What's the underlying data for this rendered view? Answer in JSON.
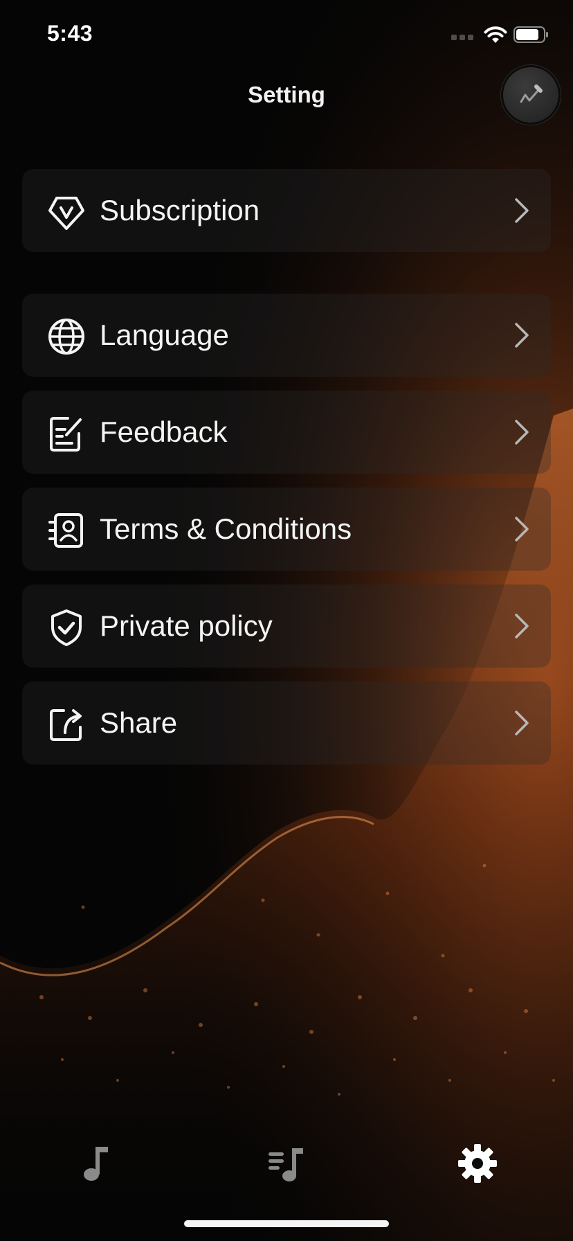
{
  "status_bar": {
    "time": "5:43",
    "icons": [
      "signal-dots-icon",
      "wifi-icon",
      "battery-icon"
    ]
  },
  "header": {
    "title": "Setting",
    "profile_icon": "microphone-icon"
  },
  "menu": {
    "items": [
      {
        "label": "Subscription",
        "icon": "vip-diamond-icon"
      },
      {
        "label": "Language",
        "icon": "globe-icon"
      },
      {
        "label": "Feedback",
        "icon": "edit-note-icon"
      },
      {
        "label": "Terms & Conditions",
        "icon": "contact-card-icon"
      },
      {
        "label": "Private policy",
        "icon": "shield-check-icon"
      },
      {
        "label": "Share",
        "icon": "share-icon"
      }
    ]
  },
  "tab_bar": {
    "tabs": [
      {
        "name": "music",
        "icon": "music-note-icon",
        "active": false
      },
      {
        "name": "playlist",
        "icon": "playlist-icon",
        "active": false
      },
      {
        "name": "settings",
        "icon": "gear-icon",
        "active": true
      }
    ]
  },
  "colors": {
    "background": "#050505",
    "accent_glow": "#d8692a",
    "row_background": "#2d2d2d",
    "text": "#f4f4f4",
    "inactive_tab": "#8a8a8a"
  }
}
